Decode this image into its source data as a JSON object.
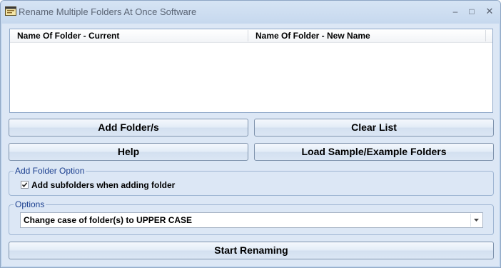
{
  "window": {
    "title": "Rename Multiple Folders At Once Software",
    "minimize_glyph": "–",
    "maximize_glyph": "□",
    "close_glyph": "✕"
  },
  "list": {
    "columns": [
      "Name Of Folder - Current",
      "Name Of Folder - New Name"
    ],
    "rows": []
  },
  "buttons": {
    "add_folders": "Add Folder/s",
    "clear_list": "Clear List",
    "help": "Help",
    "load_sample": "Load Sample/Example Folders",
    "start_renaming": "Start Renaming"
  },
  "add_folder_option": {
    "legend": "Add Folder Option",
    "subfolders_label": "Add subfolders when adding folder",
    "subfolders_checked": true
  },
  "options": {
    "legend": "Options",
    "selected": "Change case of folder(s) to UPPER CASE"
  },
  "colors": {
    "window_frame": "#c9dbf0",
    "client_background": "#dce7f5",
    "group_legend_text": "#1b3f8f"
  },
  "icons": {
    "app": "folder-rename-icon",
    "checkbox_mark": "check-icon",
    "dropdown": "chevron-down-icon"
  }
}
